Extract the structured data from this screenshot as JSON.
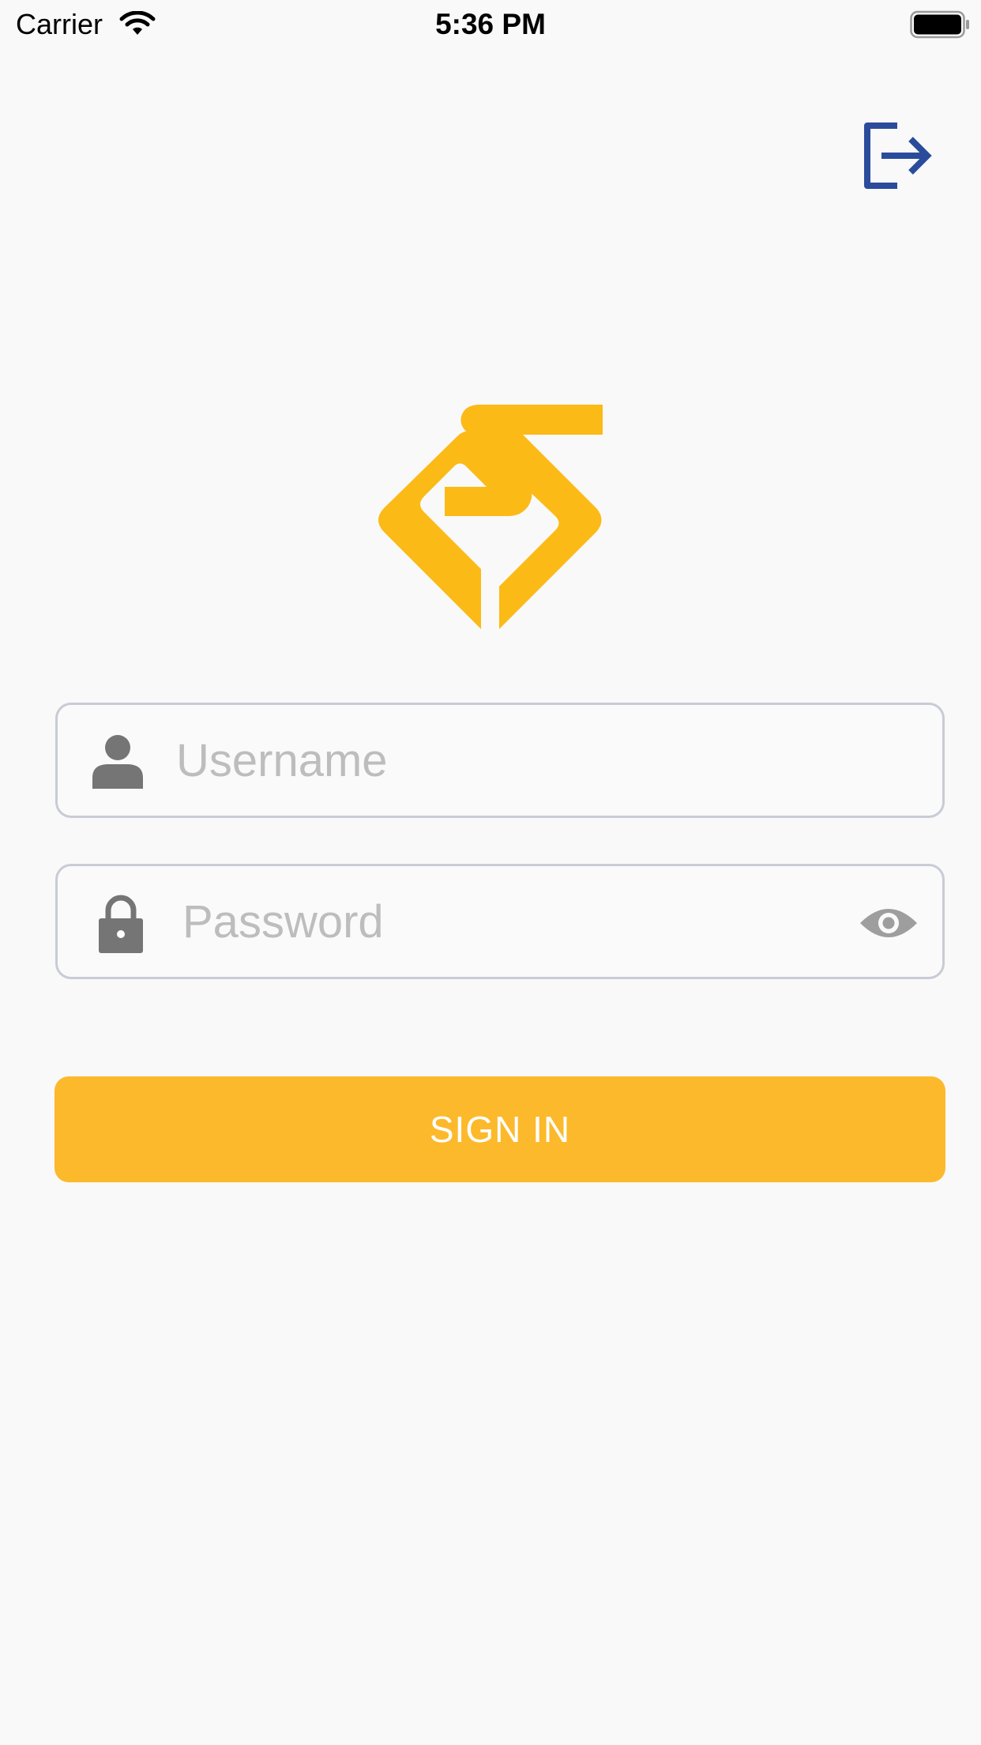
{
  "status_bar": {
    "carrier": "Carrier",
    "time": "5:36 PM"
  },
  "icons": {
    "wifi": "wifi-icon",
    "battery": "battery-icon",
    "logout": "logout-icon",
    "user": "user-icon",
    "lock": "lock-icon",
    "eye": "eye-icon"
  },
  "colors": {
    "brand_yellow": "#fcb92b",
    "logout_blue": "#2b4c9b",
    "icon_gray": "#757575",
    "background": "#f9f9f9"
  },
  "login": {
    "username_placeholder": "Username",
    "username_value": "",
    "password_placeholder": "Password",
    "password_value": "",
    "signin_label": "SIGN IN"
  }
}
